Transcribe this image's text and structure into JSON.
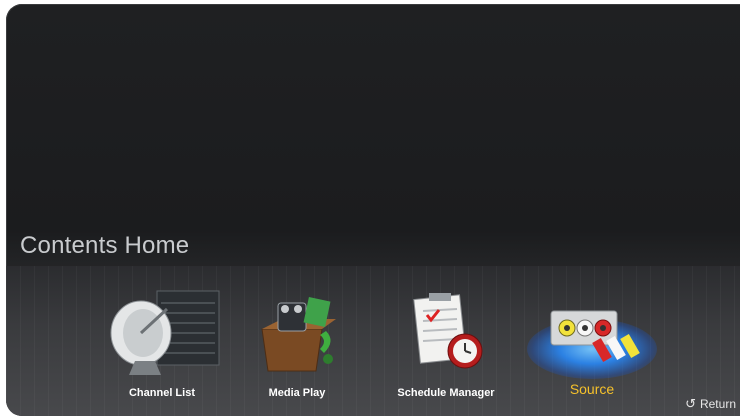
{
  "page": {
    "title": "Contents Home"
  },
  "menu": {
    "items": [
      {
        "label": "Channel List",
        "icon": "satellite-dish-icon"
      },
      {
        "label": "Media Play",
        "icon": "media-box-icon"
      },
      {
        "label": "Schedule Manager",
        "icon": "schedule-clock-icon"
      },
      {
        "label": "Source",
        "icon": "av-connector-icon",
        "selected": true
      }
    ]
  },
  "footer": {
    "return_label": "Return",
    "return_icon": "return-arrow-icon"
  },
  "colors": {
    "selected_label": "#f5c12b",
    "selection_glow": "#2a8cff"
  }
}
